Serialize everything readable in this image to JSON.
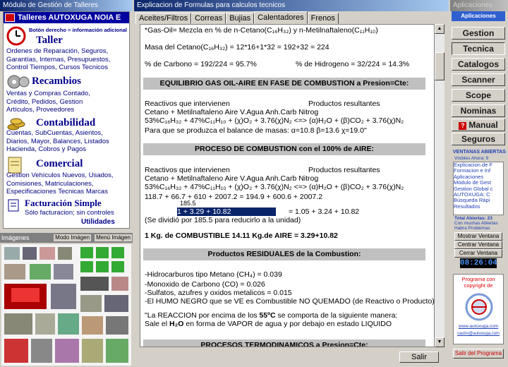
{
  "left": {
    "window_title": "Módulo de Gestión de Talleres",
    "header": "Talleres AUTOXUGA NOIA E",
    "hint": "Botón derecho = información adicional",
    "sections": [
      {
        "title": "Taller",
        "desc": [
          "Ordenes de Reparación, Seguros,",
          "Garantías, Internas, Presupuestos,",
          "Control Tiempos, Cursos Tecnicos"
        ]
      },
      {
        "title": "Recambios",
        "desc": [
          "Ventas y Compras Contado,",
          "Crédito, Pedidos,   Gestion",
          "Artículos, Proveedores"
        ]
      },
      {
        "title": "Contabilidad",
        "desc": [
          "Cuentas, SubCuentas, Asientos,",
          "Diarios, Mayor, Balances, Listados",
          "Hacienda, Cobros y Pagos"
        ]
      },
      {
        "title": "Comercial",
        "desc": [
          "Gestion Vehículos Nuevos, Usados,",
          "Comisiones, Matriculaciones,",
          "Especificaciones Tecnicas Marcas"
        ]
      }
    ],
    "fact_title": "Facturación Simple",
    "fact_desc": "Sólo facturacion; sin controles",
    "utilidades": "Utilidades"
  },
  "images": {
    "title": "Imágenes",
    "mode_btn": "Modo Imágen",
    "menu_btn": "Menú Imágen"
  },
  "main": {
    "window_title": "Explicacion de Formulas para calculos tecnicos",
    "tabs": [
      "Aceites/Filtros",
      "Correas",
      "Bujias",
      "Calentadores",
      "Frenos"
    ],
    "active_tab": 3,
    "salir": "Salir",
    "lines": {
      "l1": "*Gas-Oil= Mezcla en % de n-Cetano(C₁₆H₃₂) y n-Metilnaftaleno(C₁₁H₁₀)",
      "l2": "Masa del Cetano(C₁₆H₃₂) = 12*16+1*32 = 192+32 = 224",
      "l3a": "% de Carbono = 192/224 = 95.7%",
      "l3b": "% de Hidrogeno = 32/224 = 14.3%",
      "h1": "EQUILIBRIO GAS OIL-AIRE EN FASE DE COMBUSTION a Presion=Cte:",
      "r1": "Reactivos que intervienen",
      "p1": "Productos resultantes",
      "n1": "Cetano     +  Metilnaftaleno          Aire                       V.Agua      Anh.Carb      Nitrog",
      "e1": "53%C₁₆H₃₂ + 47%C₁₁H₁₀ + (χ)O₂ + 3.76(χ)N₂ <=> (α)H₂O + (β)CO₂ + 3.76(χ)N₂",
      "b1": "Para que se produzca el balance de masas: α=10.8 β=13.6 χ=19.0\"",
      "h2": "PROCESO DE COMBUSTION con el 100% de AIRE:",
      "r2": "Reactivos que intervienen",
      "p2": "Productos resultantes",
      "n2": "Cetano     +  Metilnaftaleno          Aire                       V.Agua      Anh.Carb      Nitrog",
      "e2": "53%C₁₆H₃₂ + 47%C₁₁H₁₀ + (χ)O₂ + 3.76(χ)N₂ <=> (α)H₂O + (β)CO₂ + 3.76(χ)N₂",
      "v1": "118.7       +        66.7         + 610   + 2007.2    =        194.9     + 600.6    + 2007.2",
      "v_div": "185.5",
      "v2a": "1                  +  3.29    +  10.82",
      "v2b": "=       1.05      +  3.24      + 10.82",
      "v_note": "(Se dividió por 185.5 para reducirlo a la unidad)",
      "kg": "1 Kg. de COMBUSTIBLE      14.11 Kg.de AIRE = 3.29+10.82",
      "h3": "Productos RESIDUALES de la Combustion:",
      "s1": "-Hidrocarburos tipo Metano (CH₄) = 0.039",
      "s2": "-Monoxido de Carbono (CO) = 0.026",
      "s3": "-Sulfatos, azufres y oxidos metalicos = 0.015",
      "s4": "-El HUMO NEGRO que se VE es Combustible NO QUEMADO (de Reactivo o Producto)",
      "s5a": "\"La REACCION por encima de los ",
      "s5b": "55ºC",
      "s5c": " se comporta de la siguiente manera:",
      "s6a": "  Sale el ",
      "s6b": "H₂O",
      "s6c": " en forma de VAPOR de agua y por debajo en estado LIQUIDO",
      "h4": "PROCESOS TERMODINAMICOS a Presion=Cte:"
    }
  },
  "right": {
    "window_title": "Aplicaciones",
    "subtitle": "Aplicaciones",
    "buttons": [
      "Gestion",
      "Tecnica",
      "Catalogos",
      "Scanner",
      "Scope",
      "Nominas",
      "Manual",
      "Seguros"
    ],
    "selected": 1,
    "ventanas_title": "VENTANAS ABIERTAS",
    "visibles": "Visibles Ahora: 9",
    "list": [
      "Explicacion de F",
      "Formacion e Inf",
      "Aplicaciones",
      "Módulo de Gest",
      "Gestion Global c",
      "AUTOXUGA: C",
      "Búsqueda Rápi",
      "Resultados"
    ],
    "total": "Total Abiertas: 23",
    "muchas": "Con muchas Abiertas",
    "problemas": "Habra Problemas",
    "mostrar": "Mostrar Ventana",
    "centrar": "Centrar Ventana",
    "cerrar": "Cerrar Ventana",
    "clock": "08:26:04",
    "copyright": [
      "Programa con",
      "copyright de"
    ],
    "web": "www.autoxuga.com",
    "mail": "castro@autoxuga.com",
    "exit": "Salir del Programa"
  }
}
